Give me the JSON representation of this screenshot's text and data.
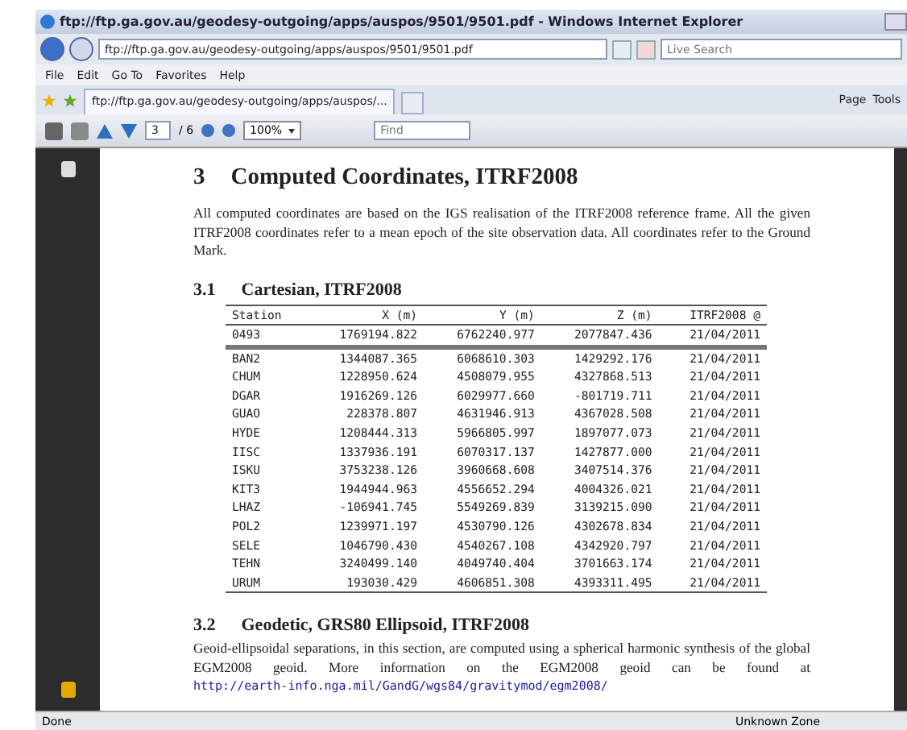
{
  "window": {
    "title": "ftp://ftp.ga.gov.au/geodesy-outgoing/apps/auspos/9501/9501.pdf - Windows Internet Explorer"
  },
  "address_bar": {
    "value": "ftp://ftp.ga.gov.au/geodesy-outgoing/apps/auspos/9501/9501.pdf"
  },
  "search": {
    "placeholder": "Live Search"
  },
  "menu": [
    "File",
    "Edit",
    "Go To",
    "Favorites",
    "Help"
  ],
  "tabs": [
    {
      "label": "ftp://ftp.ga.gov.au/geodesy-outgoing/apps/auspos/...",
      "selected": true
    }
  ],
  "command_bar": [
    "Page",
    "Tools"
  ],
  "pdf_toolbar": {
    "page": "3",
    "page_count": "/ 6",
    "zoom": "100%",
    "find_placeholder": "Find"
  },
  "document": {
    "section": {
      "number": "3",
      "title": "Computed Coordinates, ITRF2008"
    },
    "intro": "All computed coordinates are based on the IGS realisation of the ITRF2008 reference frame. All the given ITRF2008 coordinates refer to a mean epoch of the site observation data. All coordinates refer to the Ground Mark.",
    "subsection_1": {
      "number": "3.1",
      "title": "Cartesian, ITRF2008"
    },
    "table": {
      "columns": [
        "Station",
        "X (m)",
        "Y (m)",
        "Z (m)",
        "ITRF2008 @"
      ],
      "rows": [
        [
          "0493",
          "1769194.822",
          "6762240.977",
          "2077847.436",
          "21/04/2011"
        ],
        [
          "BAN2",
          "1344087.365",
          "6068610.303",
          "1429292.176",
          "21/04/2011"
        ],
        [
          "CHUM",
          "1228950.624",
          "4508079.955",
          "4327868.513",
          "21/04/2011"
        ],
        [
          "DGAR",
          "1916269.126",
          "6029977.660",
          "-801719.711",
          "21/04/2011"
        ],
        [
          "GUAO",
          "228378.807",
          "4631946.913",
          "4367028.508",
          "21/04/2011"
        ],
        [
          "HYDE",
          "1208444.313",
          "5966805.997",
          "1897077.073",
          "21/04/2011"
        ],
        [
          "IISC",
          "1337936.191",
          "6070317.137",
          "1427877.000",
          "21/04/2011"
        ],
        [
          "ISKU",
          "3753238.126",
          "3960668.608",
          "3407514.376",
          "21/04/2011"
        ],
        [
          "KIT3",
          "1944944.963",
          "4556652.294",
          "4004326.021",
          "21/04/2011"
        ],
        [
          "LHAZ",
          "-106941.745",
          "5549269.839",
          "3139215.090",
          "21/04/2011"
        ],
        [
          "POL2",
          "1239971.197",
          "4530790.126",
          "4302678.834",
          "21/04/2011"
        ],
        [
          "SELE",
          "1046790.430",
          "4540267.108",
          "4342920.797",
          "21/04/2011"
        ],
        [
          "TEHN",
          "3240499.140",
          "4049740.404",
          "3701663.174",
          "21/04/2011"
        ],
        [
          "URUM",
          "193030.429",
          "4606851.308",
          "4393311.495",
          "21/04/2011"
        ]
      ]
    },
    "subsection_2": {
      "number": "3.2",
      "title": "Geodetic, GRS80 Ellipsoid, ITRF2008"
    },
    "paragraph_2": "Geoid-ellipsoidal separations, in this section, are computed using a spherical harmonic synthesis of the global EGM2008 geoid. More information on the EGM2008 geoid can be found at",
    "link": "http://earth-info.nga.mil/GandG/wgs84/gravitymod/egm2008/"
  },
  "status_bar": {
    "left": "Done",
    "zone": "Unknown Zone"
  }
}
